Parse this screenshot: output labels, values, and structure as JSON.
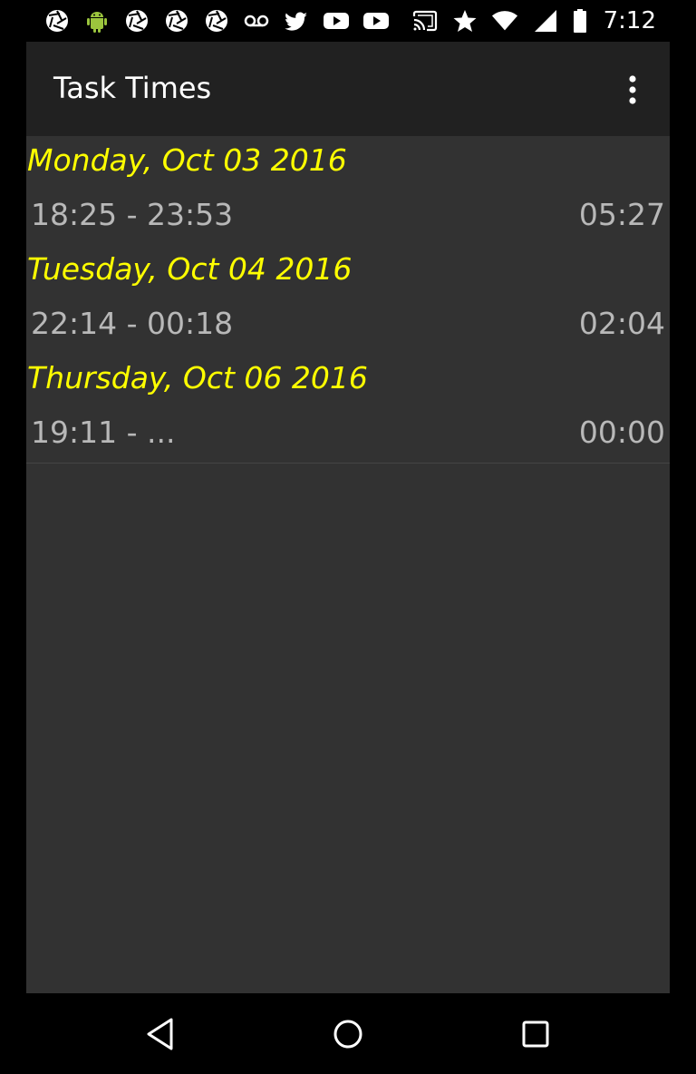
{
  "status_bar": {
    "left_icons": [
      "aperture-icon",
      "android-icon",
      "aperture-icon",
      "aperture-icon",
      "aperture-icon",
      "voicemail-icon",
      "twitter-icon",
      "youtube-icon",
      "youtube-icon"
    ],
    "right_icons": [
      "cast-icon",
      "star-icon",
      "wifi-icon",
      "signal-icon",
      "battery-icon"
    ],
    "time": "7:12"
  },
  "toolbar": {
    "title": "Task Times",
    "menu_icon": "overflow-menu-icon"
  },
  "days": [
    {
      "date": "Monday, Oct 03 2016",
      "entries": [
        {
          "range": "18:25 - 23:53",
          "duration": "05:27"
        }
      ]
    },
    {
      "date": "Tuesday, Oct 04 2016",
      "entries": [
        {
          "range": "22:14 - 00:18",
          "duration": "02:04"
        }
      ]
    },
    {
      "date": "Thursday, Oct 06 2016",
      "entries": [
        {
          "range": "19:11 - ...",
          "duration": "00:00"
        }
      ]
    }
  ],
  "nav_bar": {
    "back": "back-icon",
    "home": "home-icon",
    "recents": "recents-icon"
  },
  "colors": {
    "date_header": "#ffff00",
    "entry_text": "#b8b8b8",
    "toolbar_bg": "#212121",
    "content_bg": "#323232"
  }
}
